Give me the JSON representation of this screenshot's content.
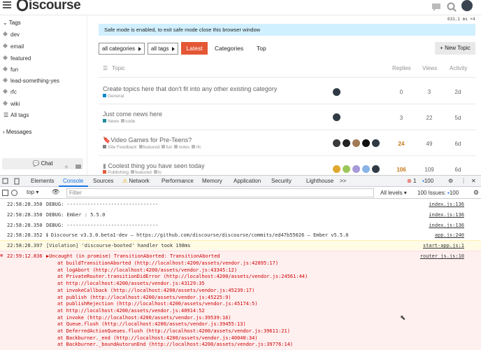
{
  "header": {
    "logo_text": "iscourse"
  },
  "perf": "631.1 ms ×4",
  "sidebar": {
    "tags_title": "Tags",
    "tags": [
      "dev",
      "email",
      "featured",
      "fun",
      "lead-something-yes",
      "rfc",
      "wiki"
    ],
    "all_tags": "All tags",
    "messages_title": "Messages",
    "chat_label": "Chat"
  },
  "banner": "Safe mode is enabled, to exit safe mode close this browser window",
  "nav": {
    "categories_dd": "all categories",
    "tags_dd": "all tags",
    "latest": "Latest",
    "categories": "Categories",
    "top": "Top",
    "new_topic": "+ New Topic"
  },
  "table": {
    "col_topic": "Topic",
    "col_replies": "Replies",
    "col_views": "Views",
    "col_activity": "Activity",
    "rows": [
      {
        "title": "Create topics here that don't fit into any other existing category",
        "category": "General",
        "cat_color": "#0088cc",
        "tags": [],
        "replies": "0",
        "views": "3",
        "activity": "2d"
      },
      {
        "title": "Just come news here",
        "category": "News",
        "cat_color": "#1c8a9c",
        "tags": [
          "code"
        ],
        "replies": "3",
        "views": "22",
        "activity": "5d"
      },
      {
        "title": "Video Games for Pre-Teens?",
        "category": "Site Feedback",
        "cat_color": "#808281",
        "tags": [
          "featured",
          "fun",
          "notes",
          "rfc"
        ],
        "replies": "24",
        "views": "49",
        "activity": "6d"
      },
      {
        "title": "Coolest thing you have seen today",
        "category": "Publishing",
        "cat_color": "#e45735",
        "tags": [
          "featured",
          "tv"
        ],
        "replies": "106",
        "views": "109",
        "activity": "6d"
      }
    ]
  },
  "devtools": {
    "tabs": [
      "Elements",
      "Console",
      "Sources",
      "Network",
      "Performance",
      "Memory",
      "Application",
      "Security",
      "Lighthouse",
      ">>"
    ],
    "err_count": "1",
    "issues_count": "100",
    "context": "top",
    "filter_placeholder": "Filter",
    "levels": "All levels ▾",
    "issues_label": "100 Issues:",
    "issues_badge": "100",
    "logs": [
      {
        "time": "22:58:28.350",
        "msg": "DEBUG: -------------------------------",
        "src": "index.js:136"
      },
      {
        "time": "22:58:28.350",
        "msg": "DEBUG: Ember : 5.5.0",
        "src": "index.js:136"
      },
      {
        "time": "22:58:28.350",
        "msg": "DEBUG: -------------------------------",
        "src": "index.js:136"
      },
      {
        "time": "22:58:28.352",
        "msg": "ℹ Discourse v3.3.0.beta1-dev — https://github.com/discourse/discourse/commits/ed47b55026 — Ember v5.5.0",
        "src": "app.js:240"
      },
      {
        "time": "22:58:28.397",
        "msg": "[Violation] 'discourse-booted' handler took 198ms",
        "src": "start-app.js:1"
      }
    ],
    "error": {
      "time": "22:59:12.836",
      "msg": "▶Uncaught (in promise) TransitionAborted: TransitionAborted",
      "src": "router_js.js:10",
      "stack": [
        "at buildTransitionAborted (http://localhost:4200/assets/vendor.js:42895:17)",
        "at logAbort (http://localhost:4200/assets/vendor.js:43345:12)",
        "at PrivateRouter.transitionDidError (http://localhost:4200/assets/vendor.js:24561:44)",
        "at http://localhost:4200/assets/vendor.js:43129:35",
        "at invokeCallback (http://localhost:4200/assets/vendor.js:45239:17)",
        "at publish (http://localhost:4200/assets/vendor.js:45225:9)",
        "at publishRejection (http://localhost:4200/assets/vendor.js:45174:5)",
        "at http://localhost:4200/assets/vendor.js:40914:52",
        "at invoke (http://localhost:4200/assets/vendor.js:39539:16)",
        "at Queue.flush (http://localhost:4200/assets/vendor.js:39455:13)",
        "at DeferredActionQueues.flush (http://localhost:4200/assets/vendor.js:39611:21)",
        "at Backburner._end (http://localhost:4200/assets/vendor.js:40040:34)",
        "at Backburner._boundAutorunEnd (http://localhost:4200/assets/vendor.js:39776:14)"
      ]
    }
  }
}
